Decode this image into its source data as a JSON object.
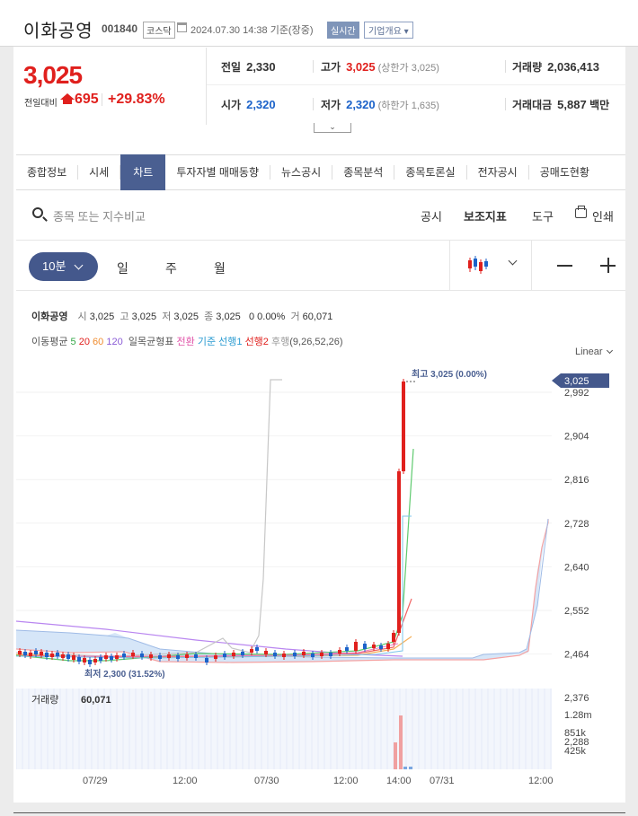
{
  "header": {
    "name": "이화공영",
    "code": "001840",
    "market": "코스닥",
    "datetime": "2024.07.30 14:38 기준(장중)",
    "realtime": "실시간",
    "info_button": "기업개요 ▾"
  },
  "price": {
    "current": "3,025",
    "diff_label": "전일대비",
    "diff": "695",
    "diff_pct": "+29.83%"
  },
  "stats": {
    "prev_label": "전일",
    "prev": "2,330",
    "high_label": "고가",
    "high": "3,025",
    "upper_limit": "(상한가 3,025)",
    "volume_label": "거래량",
    "volume": "2,036,413",
    "open_label": "시가",
    "open": "2,320",
    "low_label": "저가",
    "low": "2,320",
    "lower_limit": "(하한가 1,635)",
    "amount_label": "거래대금",
    "amount": "5,887",
    "amount_unit": "백만"
  },
  "tabs": [
    "종합정보",
    "시세",
    "차트",
    "투자자별 매매동향",
    "뉴스공시",
    "종목분석",
    "종목토론실",
    "전자공시",
    "공매도현황"
  ],
  "active_tab": "차트",
  "toolbar": {
    "search_placeholder": "종목 또는 지수비교",
    "disclosure": "공시",
    "indicator": "보조지표",
    "tools": "도구",
    "print": "인쇄"
  },
  "periods": {
    "selected": "10분",
    "day": "일",
    "week": "주",
    "month": "월"
  },
  "chart_info": {
    "name": "이화공영",
    "open_label": "시",
    "open": "3,025",
    "high_label": "고",
    "high": "3,025",
    "low_label": "저",
    "low": "3,025",
    "close_label": "종",
    "close": "3,025",
    "change": "0 0.00%",
    "vol_label": "거",
    "vol": "60,071",
    "ma_label": "이동평균",
    "ma5": "5",
    "ma20": "20",
    "ma60": "60",
    "ma120": "120",
    "ichimoku_label": "일목균형표",
    "conv": "전환",
    "base": "기준",
    "span1": "선행1",
    "span2": "선행2",
    "lag": "후행",
    "ichimoku_params": "(9,26,52,26)",
    "scale": "Linear"
  },
  "chart_data": {
    "type": "candlestick",
    "y_ticks": [
      "2,992",
      "2,904",
      "2,816",
      "2,728",
      "2,640",
      "2,552",
      "2,464",
      "2,376",
      "2,288"
    ],
    "ylim": [
      2260,
      3040
    ],
    "x_ticks": [
      "07/29",
      "12:00",
      "07/30",
      "12:00",
      "14:00",
      "07/31",
      "12:00"
    ],
    "current_price": "3,025",
    "high_annotation": "최고 3,025 (0.00%)",
    "low_annotation": "최저 2,300 (31.52%)",
    "volume_label": "거래량",
    "volume_value": "60,071",
    "volume_ticks": [
      "1.28m",
      "851k",
      "425k"
    ],
    "colors": {
      "up": "#e0201d",
      "down": "#1b62c9",
      "accent": "#44588c"
    }
  }
}
